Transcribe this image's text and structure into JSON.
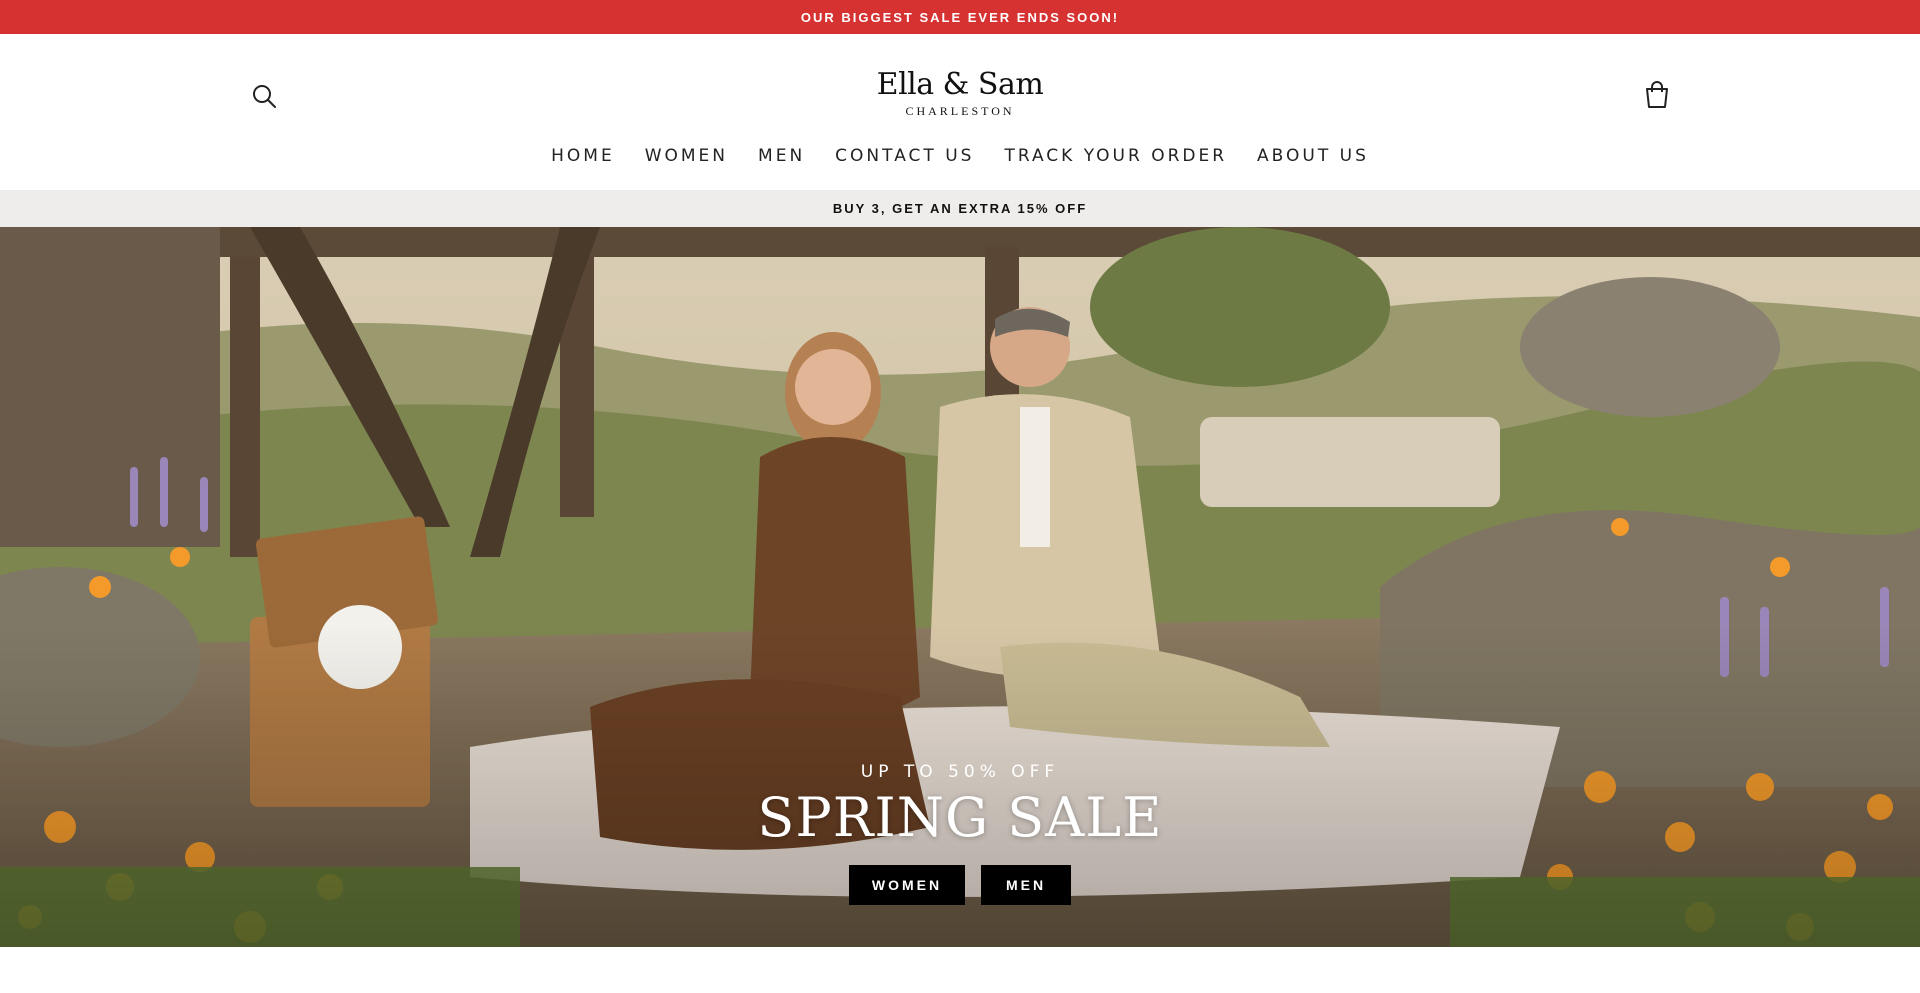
{
  "announcement": {
    "text": "OUR BIGGEST SALE EVER ENDS SOON!",
    "bg_color": "#d63232"
  },
  "header": {
    "logo_main": "Ella & Sam",
    "logo_sub": "CHARLESTON",
    "search_icon": "search-icon",
    "cart_icon": "shopping-bag-icon"
  },
  "nav": {
    "items": [
      {
        "label": "HOME"
      },
      {
        "label": "WOMEN"
      },
      {
        "label": "MEN"
      },
      {
        "label": "CONTACT US"
      },
      {
        "label": "TRACK YOUR ORDER"
      },
      {
        "label": "ABOUT US"
      }
    ]
  },
  "promo": {
    "text": "BUY 3, GET AN EXTRA 15% OFF",
    "bg_color": "#efedeb"
  },
  "hero": {
    "kicker": "UP TO 50% OFF",
    "title": "SPRING SALE",
    "buttons": [
      {
        "label": "WOMEN"
      },
      {
        "label": "MEN"
      }
    ],
    "button_color": "#000000"
  }
}
